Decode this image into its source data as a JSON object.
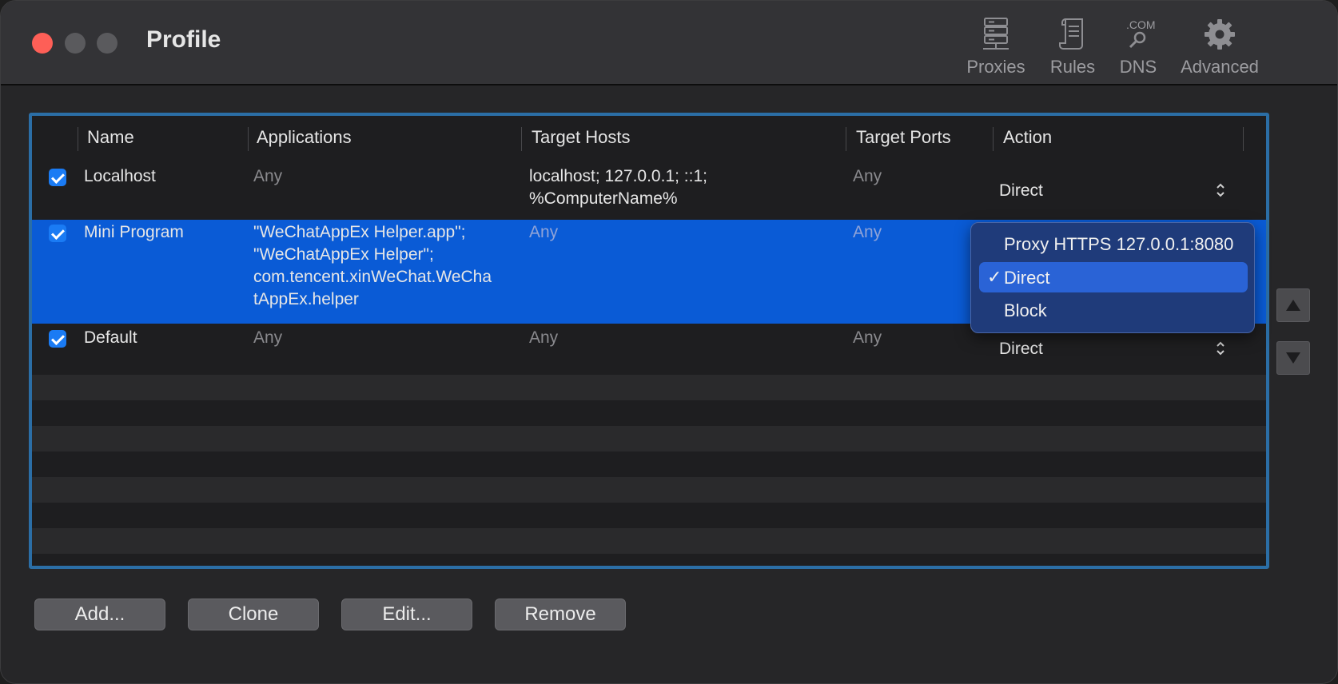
{
  "window": {
    "title": "Profile"
  },
  "toolbar": {
    "items": [
      {
        "label": "Proxies",
        "icon": "server-icon"
      },
      {
        "label": "Rules",
        "icon": "scroll-icon"
      },
      {
        "label": "DNS",
        "icon": "dns-search-icon",
        "icon_text": ".COM"
      },
      {
        "label": "Advanced",
        "icon": "gear-icon"
      }
    ]
  },
  "table": {
    "columns": [
      "Name",
      "Applications",
      "Target Hosts",
      "Target Ports",
      "Action"
    ],
    "rows": [
      {
        "enabled": true,
        "name": "Localhost",
        "applications": "Any",
        "target_hosts": "localhost; 127.0.0.1; ::1;\n%ComputerName%",
        "target_ports": "Any",
        "action": "Direct",
        "selected": false
      },
      {
        "enabled": true,
        "name": "Mini Program",
        "applications": "\"WeChatAppEx Helper.app\";\n\"WeChatAppEx Helper\";\ncom.tencent.xinWeChat.WeCha\ntAppEx.helper",
        "target_hosts": "Any",
        "target_ports": "Any",
        "action": "Direct",
        "selected": true
      },
      {
        "enabled": true,
        "name": "Default",
        "applications": "Any",
        "target_hosts": "Any",
        "target_ports": "Any",
        "action": "Direct",
        "selected": false
      }
    ]
  },
  "action_menu": {
    "options": [
      "Proxy HTTPS 127.0.0.1:8080",
      "Direct",
      "Block"
    ],
    "checked": "Direct",
    "check_glyph": "✓"
  },
  "buttons": {
    "add": "Add...",
    "clone": "Clone",
    "edit": "Edit...",
    "remove": "Remove"
  },
  "colors": {
    "selection": "#0a5bd6",
    "focus_ring": "#2b6ea6",
    "checkbox": "#1a7bf4",
    "close_light": "#fe5f57"
  }
}
